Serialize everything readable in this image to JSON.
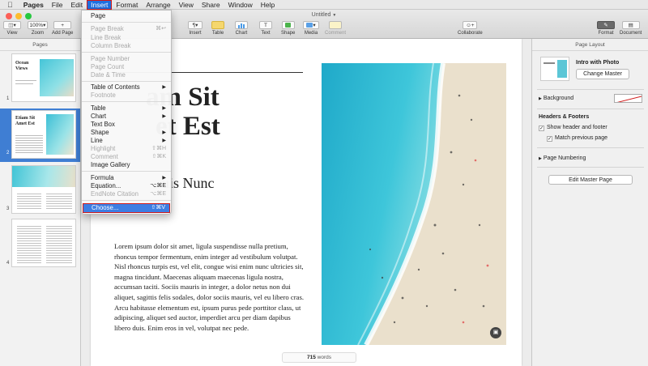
{
  "menubar": {
    "app": "Pages",
    "items": [
      "File",
      "Edit",
      "Insert",
      "Format",
      "Arrange",
      "View",
      "Share",
      "Window",
      "Help"
    ]
  },
  "window": {
    "title": "Untitled"
  },
  "toolbar": {
    "view": "View",
    "zoom_value": "100%",
    "zoom": "Zoom",
    "add_page": "Add Page",
    "insert": "Insert",
    "table": "Table",
    "chart": "Chart",
    "text": "Text",
    "shape": "Shape",
    "media": "Media",
    "comment": "Comment",
    "collaborate": "Collaborate",
    "format": "Format",
    "document": "Document",
    "text_glyph": "T"
  },
  "insert_menu": {
    "items": [
      {
        "label": "Page",
        "shortcut": "",
        "submenu": false,
        "disabled": false
      },
      {
        "label": "Page Break",
        "shortcut": "⌘↩",
        "submenu": false,
        "disabled": true
      },
      {
        "label": "Line Break",
        "shortcut": "",
        "submenu": false,
        "disabled": true
      },
      {
        "label": "Column Break",
        "shortcut": "",
        "submenu": false,
        "disabled": true
      },
      {
        "label": "Page Number",
        "shortcut": "",
        "submenu": false,
        "disabled": true
      },
      {
        "label": "Page Count",
        "shortcut": "",
        "submenu": false,
        "disabled": true
      },
      {
        "label": "Date & Time",
        "shortcut": "",
        "submenu": false,
        "disabled": true
      },
      {
        "label": "Table of Contents",
        "shortcut": "",
        "submenu": true,
        "disabled": false
      },
      {
        "label": "Footnote",
        "shortcut": "",
        "submenu": false,
        "disabled": true
      },
      {
        "label": "Table",
        "shortcut": "",
        "submenu": true,
        "disabled": false
      },
      {
        "label": "Chart",
        "shortcut": "",
        "submenu": true,
        "disabled": false
      },
      {
        "label": "Text Box",
        "shortcut": "",
        "submenu": false,
        "disabled": false
      },
      {
        "label": "Shape",
        "shortcut": "",
        "submenu": true,
        "disabled": false
      },
      {
        "label": "Line",
        "shortcut": "",
        "submenu": true,
        "disabled": false
      },
      {
        "label": "Highlight",
        "shortcut": "⇧⌘H",
        "submenu": false,
        "disabled": true
      },
      {
        "label": "Comment",
        "shortcut": "⇧⌘K",
        "submenu": false,
        "disabled": true
      },
      {
        "label": "Image Gallery",
        "shortcut": "",
        "submenu": false,
        "disabled": false
      },
      {
        "label": "Formula",
        "shortcut": "",
        "submenu": true,
        "disabled": false
      },
      {
        "label": "Equation...",
        "shortcut": "⌥⌘E",
        "submenu": false,
        "disabled": false
      },
      {
        "label": "EndNote Citation",
        "shortcut": "⌥⌘E",
        "submenu": false,
        "disabled": true
      },
      {
        "label": "Choose...",
        "shortcut": "⇧⌘V",
        "submenu": false,
        "disabled": false
      }
    ]
  },
  "pages_panel": {
    "header": "Pages",
    "thumbnails": [
      {
        "number": "1",
        "title": "Ocean Views"
      },
      {
        "number": "2",
        "title": "Etiam Sit Amet Est"
      },
      {
        "number": "3",
        "title": ""
      },
      {
        "number": "4",
        "title": ""
      }
    ]
  },
  "document": {
    "heading_line1": "am Sit",
    "heading_line2": "et Est",
    "subheading": "uis Nunc",
    "body": "Lorem ipsum dolor sit amet, ligula suspendisse nulla pretium, rhoncus tempor fermentum, enim integer ad vestibulum volutpat. Nisl rhoncus turpis est, vel elit, congue wisi enim nunc ultricies sit, magna tincidunt. Maecenas aliquam maecenas ligula nostra, accumsan taciti. Sociis mauris in integer, a dolor netus non dui aliquet, sagittis felis sodales, dolor sociis mauris, vel eu libero cras. Arcu habitasse elementum est, ipsum purus pede porttitor class, ut adipiscing, aliquet sed auctor, imperdiet arcu per diam dapibus libero duis. Enim eros in vel, volutpat nec pede.",
    "word_count": "715",
    "words_label": "words"
  },
  "inspector": {
    "header": "Page Layout",
    "master_name": "Intro with Photo",
    "change_master": "Change Master",
    "background": "Background",
    "headers_footers": "Headers & Footers",
    "show_header_footer": "Show header and footer",
    "match_previous": "Match previous page",
    "page_numbering": "Page Numbering",
    "edit_master": "Edit Master Page"
  },
  "colors": {
    "accent": "#3d7ee3",
    "highlight_box": "#d11a1a",
    "selection": "#3f7ed3"
  }
}
